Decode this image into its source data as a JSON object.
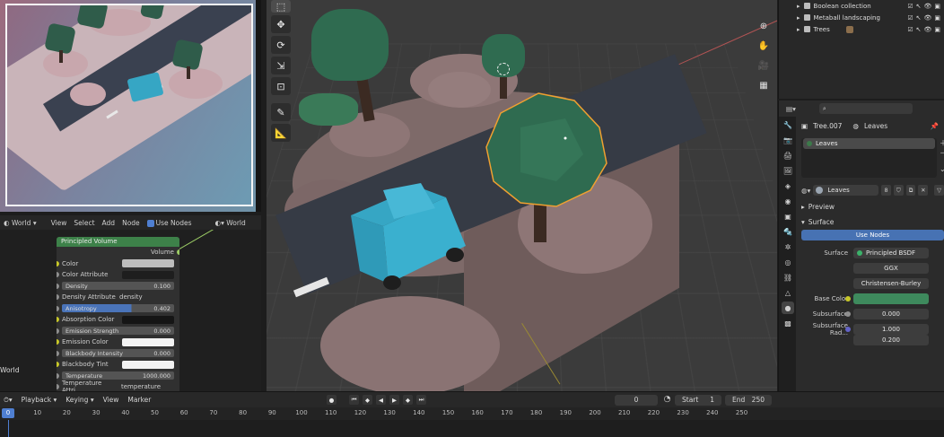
{
  "node_editor": {
    "header": {
      "world_selector": "World",
      "menus": [
        "View",
        "Select",
        "Add",
        "Node"
      ],
      "use_nodes_label": "Use Nodes",
      "world_dropdown": "World"
    },
    "world_label": "World",
    "principled_volume": {
      "title": "Principled Volume",
      "output": "Volume",
      "inputs": {
        "color": "Color",
        "color_attribute": "Color Attribute",
        "density_label": "Density",
        "density_value": "0.100",
        "density_attribute_label": "Density Attribute",
        "density_attribute_value": "density",
        "anisotropy_label": "Anisotropy",
        "anisotropy_value": "0.402",
        "absorption_color": "Absorption Color",
        "emission_strength_label": "Emission Strength",
        "emission_strength_value": "0.000",
        "emission_color": "Emission Color",
        "blackbody_intensity_label": "Blackbody Intensity",
        "blackbody_intensity_value": "0.000",
        "blackbody_tint": "Blackbody Tint",
        "temperature_label": "Temperature",
        "temperature_value": "1000.000",
        "temperature_attribute_label": "Temperature Attri...",
        "temperature_attribute_value": "temperature"
      }
    }
  },
  "outliner": {
    "items": [
      {
        "name": "Boolean collection"
      },
      {
        "name": "Metaball landscaping"
      },
      {
        "name": "Trees"
      }
    ]
  },
  "properties": {
    "search_placeholder": "",
    "breadcrumb_object": "Tree.007",
    "breadcrumb_material": "Leaves",
    "material_slot": "Leaves",
    "material_name": "Leaves",
    "user_count": "8",
    "sections": {
      "preview": "Preview",
      "surface": "Surface"
    },
    "use_nodes_button": "Use Nodes",
    "surface_label": "Surface",
    "surface_value": "Principled BSDF",
    "distribution": "GGX",
    "subsurface_method": "Christensen-Burley",
    "base_color_label": "Base Color",
    "base_color_hex": "#3e8a5d",
    "subsurface_label": "Subsurface",
    "subsurface_value": "0.000",
    "subsurface_radius_label": "Subsurface Rad...",
    "subsurface_radius_values": [
      "1.000",
      "0.200"
    ]
  },
  "timeline": {
    "menus": [
      "Playback",
      "Keying",
      "View",
      "Marker"
    ],
    "current_frame": "0",
    "start_label": "Start",
    "start_value": "1",
    "end_label": "End",
    "end_value": "250",
    "ruler_ticks": [
      "0",
      "10",
      "20",
      "30",
      "40",
      "50",
      "60",
      "70",
      "80",
      "90",
      "100",
      "110",
      "120",
      "130",
      "140",
      "150",
      "160",
      "170",
      "180",
      "190",
      "200",
      "210",
      "220",
      "230",
      "240",
      "250"
    ]
  },
  "colors": {
    "accent": "#4772b3",
    "node_header_green": "#3d8149",
    "selection_outline": "#f0a030"
  }
}
